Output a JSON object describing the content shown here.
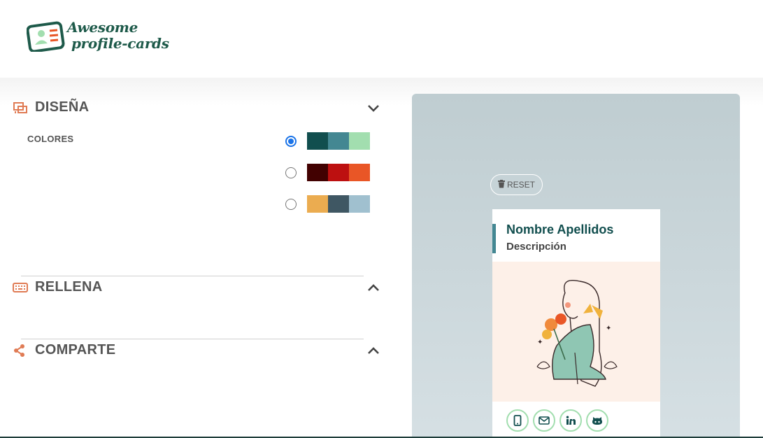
{
  "header": {
    "logo_line1": "Awesome",
    "logo_line2": "profile-cards"
  },
  "sections": {
    "design": {
      "title": "DISEÑA",
      "icon": "design-icon",
      "expanded": true
    },
    "fill": {
      "title": "RELLENA",
      "icon": "keyboard-icon",
      "expanded": false
    },
    "share": {
      "title": "COMPARTE",
      "icon": "share-icon",
      "expanded": false
    }
  },
  "colors": {
    "label": "COLORES",
    "palettes": [
      {
        "selected": true,
        "swatches": [
          "#114e4e",
          "#438792",
          "#a2deaf"
        ]
      },
      {
        "selected": false,
        "swatches": [
          "#420101",
          "#bd1010",
          "#e95626"
        ]
      },
      {
        "selected": false,
        "swatches": [
          "#ebac50",
          "#3f5763",
          "#a0c0cf"
        ]
      }
    ]
  },
  "preview": {
    "reset_label": "RESET",
    "card": {
      "name": "Nombre Apellidos",
      "description": "Descripción",
      "socials": [
        "phone-icon",
        "email-icon",
        "linkedin-icon",
        "github-icon"
      ]
    }
  }
}
